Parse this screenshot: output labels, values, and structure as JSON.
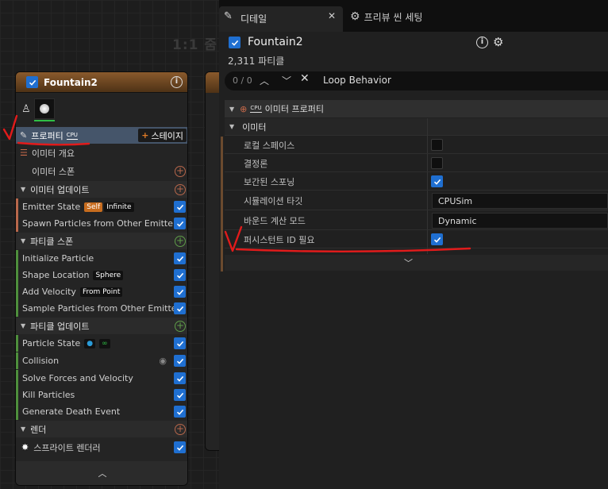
{
  "graph": {
    "zoom": "1:1 줌"
  },
  "node": {
    "title": "Fountain2",
    "properties_label": "프로퍼티",
    "cpu_badge": "CPU",
    "stage_label": "스테이지",
    "summary_label": "이미터 개요",
    "spawn_label": "이미터 스폰",
    "emitter_update": "이미터 업데이트",
    "emitter_state": "Emitter State",
    "self_pill": "Self",
    "infinite_pill": "Infinite",
    "spawn_other": "Spawn Particles from Other Emitter",
    "particle_spawn": "파티클 스폰",
    "init_particle": "Initialize Particle",
    "shape_location": "Shape Location",
    "sphere_pill": "Sphere",
    "add_velocity": "Add Velocity",
    "from_point_pill": "From Point",
    "sample_other": "Sample Particles from Other Emitter",
    "particle_update": "파티클 업데이트",
    "particle_state": "Particle State",
    "collision": "Collision",
    "solve_forces": "Solve Forces and Velocity",
    "kill_particles": "Kill Particles",
    "death_event": "Generate Death Event",
    "render": "렌더",
    "sprite": "스프라이트 렌더러"
  },
  "tabs": {
    "details": "디테일",
    "preview": "프리뷰 씬 세팅"
  },
  "details": {
    "name": "Fountain2",
    "count": "2,311 파티클",
    "search_count": "0 / 0",
    "search_value": "Loop Behavior",
    "category_cpu": "CPU",
    "category": "이미터 프로퍼티",
    "subcategory": "이미터",
    "props": [
      {
        "label": "로컬 스페이스",
        "type": "check",
        "checked": false
      },
      {
        "label": "결정론",
        "type": "check",
        "checked": false
      },
      {
        "label": "보간된 스포닝",
        "type": "check",
        "checked": true
      },
      {
        "label": "시뮬레이션 타깃",
        "type": "dropdown",
        "value": "CPUSim"
      },
      {
        "label": "바운드 계산 모드",
        "type": "dropdown",
        "value": "Dynamic"
      },
      {
        "label": "퍼시스턴트 ID 필요",
        "type": "check",
        "checked": true
      }
    ]
  },
  "colors": {
    "accent": "#1f6fd1",
    "annotation": "#e21b1b",
    "node_header": "#8a5a2c"
  }
}
